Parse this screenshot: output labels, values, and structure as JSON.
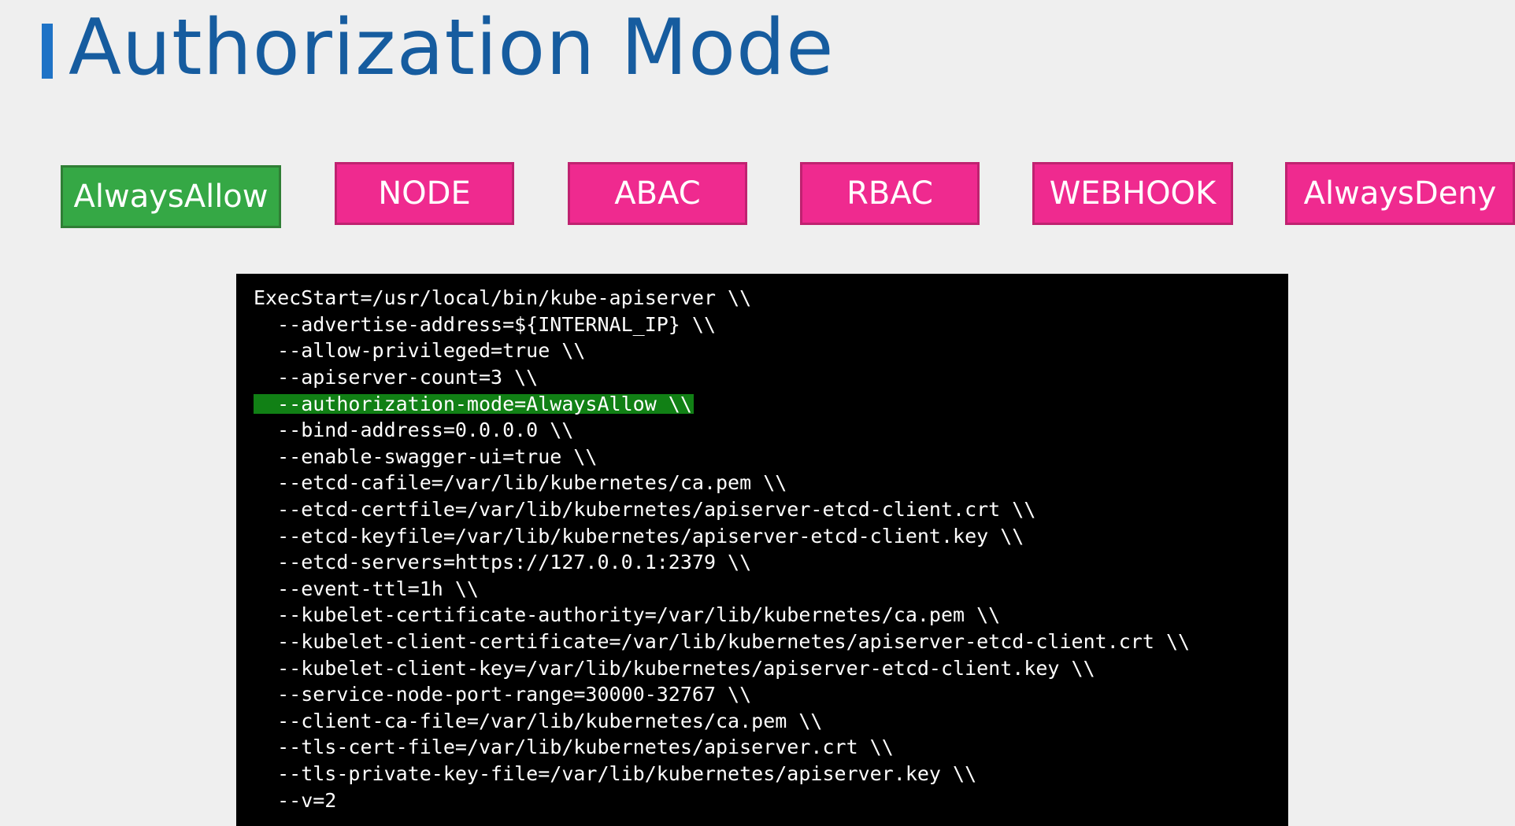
{
  "title": "Authorization Mode",
  "modes": [
    {
      "label": "AlwaysAllow",
      "status": "selected"
    },
    {
      "label": "NODE",
      "status": "option"
    },
    {
      "label": "ABAC",
      "status": "option"
    },
    {
      "label": "RBAC",
      "status": "option"
    },
    {
      "label": "WEBHOOK",
      "status": "option"
    },
    {
      "label": "AlwaysDeny",
      "status": "option"
    }
  ],
  "terminal": {
    "lines": [
      "ExecStart=/usr/local/bin/kube-apiserver \\\\",
      "  --advertise-address=${INTERNAL_IP} \\\\",
      "  --allow-privileged=true \\\\",
      "  --apiserver-count=3 \\\\",
      "  --authorization-mode=AlwaysAllow \\\\",
      "  --bind-address=0.0.0.0 \\\\",
      "  --enable-swagger-ui=true \\\\",
      "  --etcd-cafile=/var/lib/kubernetes/ca.pem \\\\",
      "  --etcd-certfile=/var/lib/kubernetes/apiserver-etcd-client.crt \\\\",
      "  --etcd-keyfile=/var/lib/kubernetes/apiserver-etcd-client.key \\\\",
      "  --etcd-servers=https://127.0.0.1:2379 \\\\",
      "  --event-ttl=1h \\\\",
      "  --kubelet-certificate-authority=/var/lib/kubernetes/ca.pem \\\\",
      "  --kubelet-client-certificate=/var/lib/kubernetes/apiserver-etcd-client.crt \\\\",
      "  --kubelet-client-key=/var/lib/kubernetes/apiserver-etcd-client.key \\\\",
      "  --service-node-port-range=30000-32767 \\\\",
      "  --client-ca-file=/var/lib/kubernetes/ca.pem \\\\",
      "  --tls-cert-file=/var/lib/kubernetes/apiserver.crt \\\\",
      "  --tls-private-key-file=/var/lib/kubernetes/apiserver.key \\\\",
      "  --v=2"
    ],
    "highlighted_line": "  --authorization-mode=AlwaysAllow \\\\",
    "highlight_color": "#118015"
  },
  "colors": {
    "title": "#165c9f",
    "title_bar": "#1f73c6",
    "selected_mode": "#35a845",
    "option_mode": "#ef2a8f",
    "terminal_background": "#000000"
  }
}
